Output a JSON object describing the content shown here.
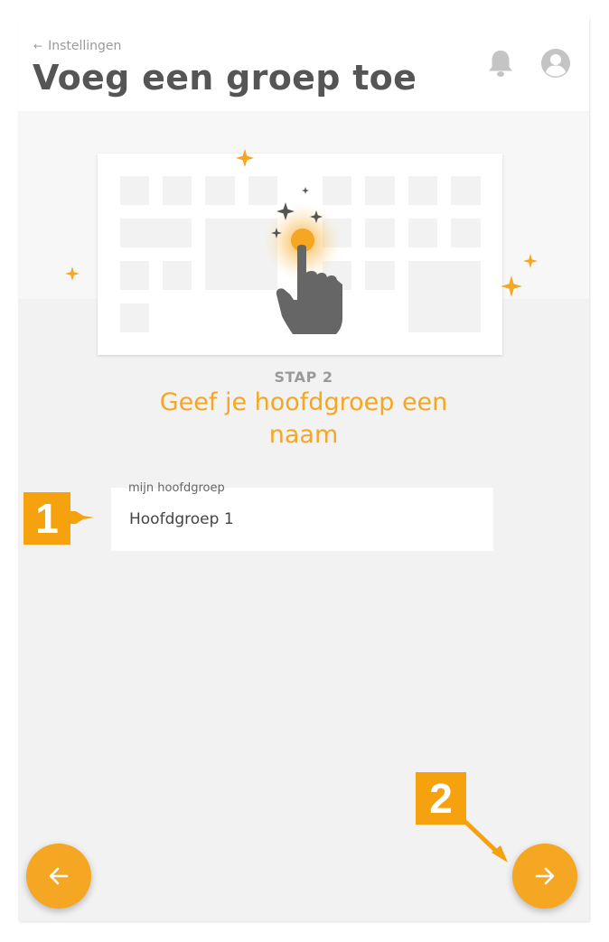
{
  "header": {
    "back_label": "Instellingen",
    "title": "Voeg een groep toe"
  },
  "step": {
    "label": "STAP 2",
    "heading": "Geef je hoofdgroep een naam"
  },
  "name_field": {
    "label": "mijn hoofdgroep",
    "value": "Hoofdgroep 1"
  },
  "navigation": {
    "prev_icon": "arrow-left-icon",
    "next_icon": "arrow-right-icon"
  },
  "callouts": {
    "first": "1",
    "second": "2"
  },
  "icons": {
    "notifications": "bell-icon",
    "account": "user-avatar-icon",
    "illustration": "pointing-hand-icon"
  },
  "colors": {
    "accent": "#f5a623",
    "title": "#555555",
    "muted": "#9a9a9a",
    "background": "#f2f2f2",
    "callout": "#f5a20e"
  }
}
